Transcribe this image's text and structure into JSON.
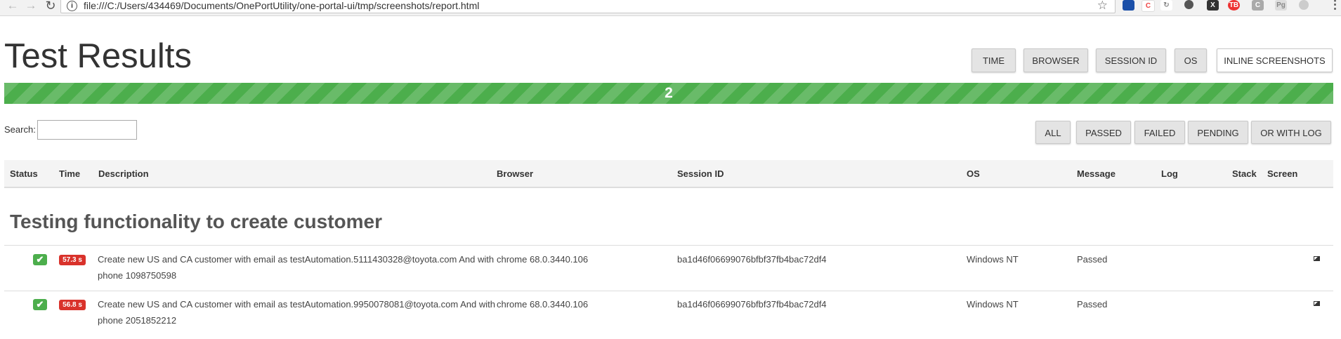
{
  "browser": {
    "url": "file:///C:/Users/434469/Documents/OnePortUtility/one-portal-ui/tmp/screenshots/report.html",
    "extension_colors": [
      "#1a4fa8",
      "#e44",
      "#888",
      "#555",
      "#333",
      "#e33",
      "#aaa",
      "#aaa",
      "#aaa"
    ]
  },
  "header": {
    "title": "Test Results",
    "toggles": [
      "TIME",
      "BROWSER",
      "SESSION ID",
      "OS"
    ],
    "inline_screenshots": "INLINE SCREENSHOTS"
  },
  "progress": {
    "label": "2",
    "passed_fraction": 1.0,
    "color": "#4cae4c"
  },
  "search": {
    "label": "Search:",
    "value": ""
  },
  "filters": [
    "ALL",
    "PASSED",
    "FAILED",
    "PENDING",
    "OR WITH LOG"
  ],
  "table": {
    "columns": {
      "status": "Status",
      "time": "Time",
      "description": "Description",
      "browser": "Browser",
      "session": "Session ID",
      "os": "OS",
      "message": "Message",
      "log": "Log",
      "stack": "Stack",
      "screen": "Screen"
    },
    "group_title": "Testing functionality to create customer",
    "rows": [
      {
        "status": "passed",
        "time": "57.3 s",
        "description": "Create new US and CA customer with email as testAutomation.5111430328@toyota.com And with phone 1098750598",
        "browser": "chrome 68.0.3440.106",
        "session": "ba1d46f06699076bfbf37fb4bac72df4",
        "os": "Windows NT",
        "message": "Passed",
        "screen_icon": "image-icon"
      },
      {
        "status": "passed",
        "time": "56.8 s",
        "description": "Create new US and CA customer with email as testAutomation.9950078081@toyota.com And with phone 2051852212",
        "browser": "chrome 68.0.3440.106",
        "session": "ba1d46f06699076bfbf37fb4bac72df4",
        "os": "Windows NT",
        "message": "Passed",
        "screen_icon": "image-icon"
      }
    ]
  },
  "colors": {
    "passed": "#4cae4c",
    "time_badge": "#d9322b"
  }
}
